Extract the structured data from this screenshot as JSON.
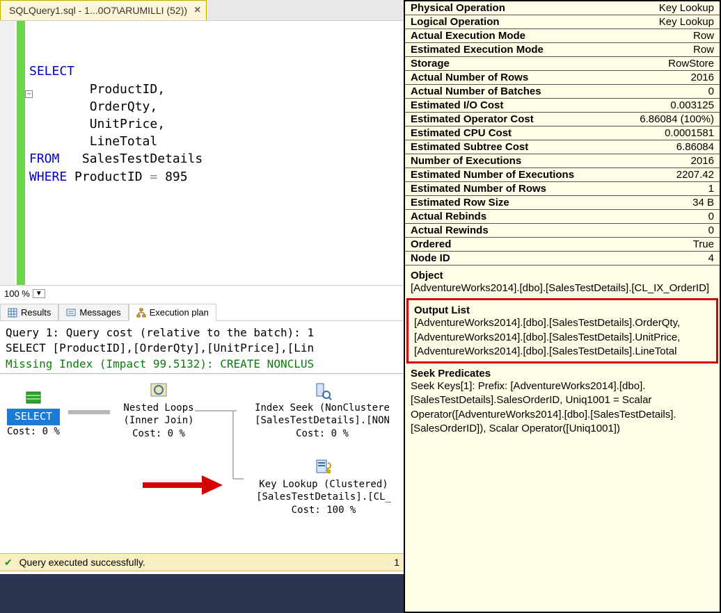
{
  "tab": {
    "title": "SQLQuery1.sql - 1...0O7\\ARUMILLI (52))"
  },
  "code": {
    "l1": "SELECT",
    "l2": "        ProductID,",
    "l3": "        OrderQty,",
    "l4": "        UnitPrice,",
    "l5": "        LineTotal",
    "l6": "FROM   SalesTestDetails",
    "l7": "WHERE ProductID = 895"
  },
  "zoom": {
    "value": "100 %"
  },
  "resultTabs": {
    "results": "Results",
    "messages": "Messages",
    "plan": "Execution plan"
  },
  "plan": {
    "line1": "Query 1: Query cost (relative to the batch): 1",
    "line2": "SELECT [ProductID],[OrderQty],[UnitPrice],[Lin",
    "line3": "Missing Index (Impact 99.5132): CREATE NONCLUS",
    "nodes": {
      "select": {
        "title": "SELECT",
        "cost": "Cost: 0 %"
      },
      "nested": {
        "title": "Nested Loops",
        "sub": "(Inner Join)",
        "cost": "Cost: 0 %"
      },
      "seek": {
        "title": "Index Seek (NonClustere",
        "sub": "[SalesTestDetails].[NON",
        "cost": "Cost: 0 %"
      },
      "lookup": {
        "title": "Key Lookup (Clustered)",
        "sub": "[SalesTestDetails].[CL_",
        "cost": "Cost: 100 %"
      }
    }
  },
  "status": {
    "text": "Query executed successfully.",
    "extra": "1"
  },
  "tooltip": {
    "rows": [
      {
        "lbl": "Physical Operation",
        "val": "Key Lookup"
      },
      {
        "lbl": "Logical Operation",
        "val": "Key Lookup"
      },
      {
        "lbl": "Actual Execution Mode",
        "val": "Row"
      },
      {
        "lbl": "Estimated Execution Mode",
        "val": "Row"
      },
      {
        "lbl": "Storage",
        "val": "RowStore"
      },
      {
        "lbl": "Actual Number of Rows",
        "val": "2016"
      },
      {
        "lbl": "Actual Number of Batches",
        "val": "0"
      },
      {
        "lbl": "Estimated I/O Cost",
        "val": "0.003125"
      },
      {
        "lbl": "Estimated Operator Cost",
        "val": "6.86084 (100%)"
      },
      {
        "lbl": "Estimated CPU Cost",
        "val": "0.0001581"
      },
      {
        "lbl": "Estimated Subtree Cost",
        "val": "6.86084"
      },
      {
        "lbl": "Number of Executions",
        "val": "2016"
      },
      {
        "lbl": "Estimated Number of Executions",
        "val": "2207.42"
      },
      {
        "lbl": "Estimated Number of Rows",
        "val": "1"
      },
      {
        "lbl": "Estimated Row Size",
        "val": "34 B"
      },
      {
        "lbl": "Actual Rebinds",
        "val": "0"
      },
      {
        "lbl": "Actual Rewinds",
        "val": "0"
      },
      {
        "lbl": "Ordered",
        "val": "True"
      },
      {
        "lbl": "Node ID",
        "val": "4"
      }
    ],
    "object": {
      "hdr": "Object",
      "body": "[AdventureWorks2014].[dbo].[SalesTestDetails].[CL_IX_OrderID]"
    },
    "output": {
      "hdr": "Output List",
      "body": "[AdventureWorks2014].[dbo].[SalesTestDetails].OrderQty, [AdventureWorks2014].[dbo].[SalesTestDetails].UnitPrice, [AdventureWorks2014].[dbo].[SalesTestDetails].LineTotal"
    },
    "seek": {
      "hdr": "Seek Predicates",
      "body": "Seek Keys[1]: Prefix: [AdventureWorks2014].[dbo].[SalesTestDetails].SalesOrderID, Uniq1001 = Scalar Operator([AdventureWorks2014].[dbo].[SalesTestDetails].[SalesOrderID]), Scalar Operator([Uniq1001])"
    }
  }
}
